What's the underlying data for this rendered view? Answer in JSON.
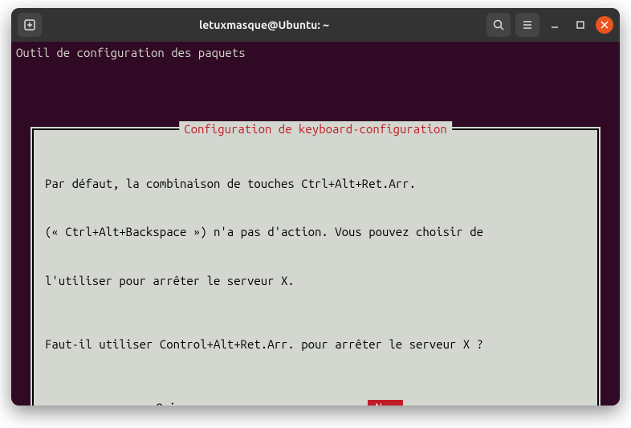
{
  "titlebar": {
    "title": "letuxmasque@Ubuntu: ~"
  },
  "terminal": {
    "header": "Outil de configuration des paquets"
  },
  "dialog": {
    "title": " Configuration de keyboard-configuration ",
    "line1": "Par défaut, la combinaison de touches Ctrl+Alt+Ret.Arr.",
    "line2": "(« Ctrl+Alt+Backspace ») n'a pas d'action. Vous pouvez choisir de",
    "line3": "l'utiliser pour arrêter le serveur X.",
    "question": "Faut-il utiliser Control+Alt+Ret.Arr. pour arrêter le serveur X ?",
    "yes": "<Oui>",
    "no": "<Non>"
  }
}
